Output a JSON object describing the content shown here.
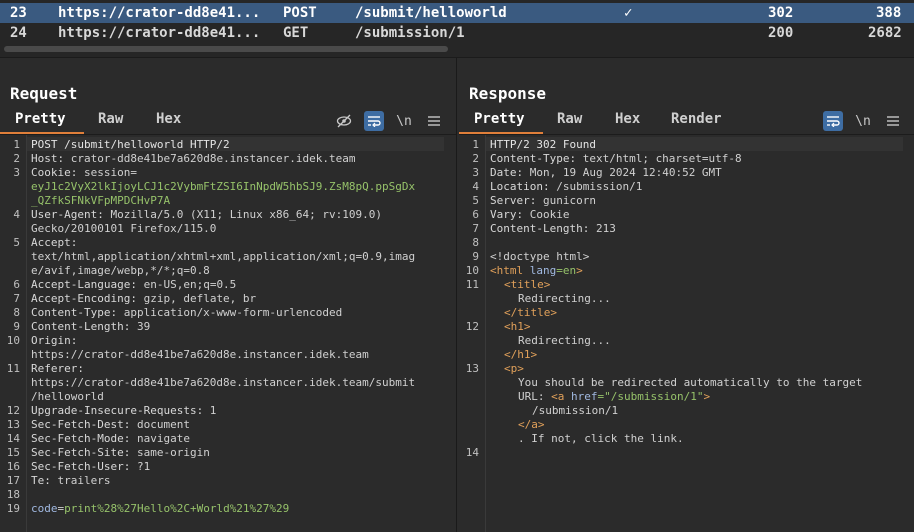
{
  "history": {
    "rows": [
      {
        "num": "23",
        "host": "https://crator-dd8e41...",
        "method": "POST",
        "path": "/submit/helloworld",
        "edited": "✓",
        "status": "302",
        "length": "388"
      },
      {
        "num": "24",
        "host": "https://crator-dd8e41...",
        "method": "GET",
        "path": "/submission/1",
        "edited": "",
        "status": "200",
        "length": "2682"
      }
    ]
  },
  "request": {
    "title": "Request",
    "tabs": [
      "Pretty",
      "Raw",
      "Hex"
    ],
    "newline_label": "\\n",
    "line_numbers": [
      "1",
      "2",
      "3",
      "",
      "",
      "4",
      "",
      "5",
      "",
      "",
      "6",
      "7",
      "8",
      "9",
      "10",
      "",
      "11",
      "",
      "12",
      "13",
      "14",
      "15",
      "16",
      "17",
      "18",
      "19"
    ],
    "lines": {
      "l1": "POST /submit/helloworld HTTP/2",
      "l2k": "Host:",
      "l2v": " crator-dd8e41be7a620d8e.instancer.idek.team",
      "l3k": "Cookie:",
      "l3v": " session=",
      "l3a": "eyJ1c2VyX2lkIjoyLCJ1c2VybmFtZSI6InNpdW5hbSJ9.ZsM8pQ.ppSgDx",
      "l3b": "_QZfkSFNkVFpMPDCHvP7A",
      "l4k": "User-Agent:",
      "l4v": " Mozilla/5.0 (X11; Linux x86_64; rv:109.0)",
      "l4b": "Gecko/20100101 Firefox/115.0",
      "l5k": "Accept:",
      "l5a": "text/html,application/xhtml+xml,application/xml;q=0.9,imag",
      "l5b": "e/avif,image/webp,*/*;q=0.8",
      "l6k": "Accept-Language:",
      "l6v": " en-US,en;q=0.5",
      "l7k": "Accept-Encoding:",
      "l7v": " gzip, deflate, br",
      "l8k": "Content-Type:",
      "l8v": " application/x-www-form-urlencoded",
      "l9k": "Content-Length:",
      "l9v": " 39",
      "l10k": "Origin:",
      "l10a": "https://crator-dd8e41be7a620d8e.instancer.idek.team",
      "l11k": "Referer:",
      "l11a": "https://crator-dd8e41be7a620d8e.instancer.idek.team/submit",
      "l11b": "/helloworld",
      "l12k": "Upgrade-Insecure-Requests:",
      "l12v": " 1",
      "l13k": "Sec-Fetch-Dest:",
      "l13v": " document",
      "l14k": "Sec-Fetch-Mode:",
      "l14v": " navigate",
      "l15k": "Sec-Fetch-Site:",
      "l15v": " same-origin",
      "l16k": "Sec-Fetch-User:",
      "l16v": " ?1",
      "l17k": "Te:",
      "l17v": " trailers",
      "l19k": "code",
      "l19e": "=",
      "l19v": "print%28%27Hello%2C+World%21%27%29"
    }
  },
  "response": {
    "title": "Response",
    "tabs": [
      "Pretty",
      "Raw",
      "Hex",
      "Render"
    ],
    "newline_label": "\\n",
    "line_numbers": [
      "1",
      "2",
      "3",
      "4",
      "5",
      "6",
      "7",
      "8",
      "9",
      "10",
      "11",
      "",
      "",
      "12",
      "",
      "",
      "13",
      "",
      "",
      "",
      "",
      "14"
    ],
    "lines": {
      "l1": "HTTP/2 302 Found",
      "l2k": "Content-Type:",
      "l2v": " text/html; charset=utf-8",
      "l3k": "Date:",
      "l3v": " Mon, 19 Aug 2024 12:40:52 GMT",
      "l4k": "Location:",
      "l4v": " /submission/1",
      "l5k": "Server:",
      "l5v": " gunicorn",
      "l6k": "Vary:",
      "l6v": " Cookie",
      "l7k": "Content-Length:",
      "l7v": " 213",
      "l9": "<!doctype html>",
      "l10a": "<html ",
      "l10b": "lang",
      "l10c": "=en",
      "l10d": ">",
      "l11a": "<title>",
      "l11b": "Redirecting...",
      "l11c": "</title>",
      "l12a": "<h1>",
      "l12b": "Redirecting...",
      "l12c": "</h1>",
      "l13a": "<p>",
      "l13b": "You should be redirected automatically to the target",
      "l13c1": "URL: ",
      "l13c2": "<a ",
      "l13c3": "href",
      "l13c4": "=\"/submission/1\"",
      "l13c5": ">",
      "l13d": "/submission/1",
      "l13e": "</a>",
      "l13f": ". If not, click the link."
    }
  }
}
